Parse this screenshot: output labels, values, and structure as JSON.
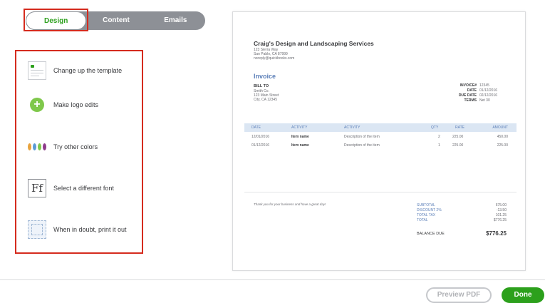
{
  "tabs": [
    {
      "label": "Design",
      "active": true
    },
    {
      "label": "Content",
      "active": false
    },
    {
      "label": "Emails",
      "active": false
    }
  ],
  "options": [
    {
      "label": "Change up the template",
      "icon": "template-icon"
    },
    {
      "label": "Make logo edits",
      "icon": "add-logo-icon"
    },
    {
      "label": "Try other colors",
      "icon": "color-palette-icon"
    },
    {
      "label": "Select a different font",
      "icon": "font-icon",
      "glyph": "Ff"
    },
    {
      "label": "When in doubt, print it out",
      "icon": "print-layout-icon"
    }
  ],
  "palette": [
    "#e8a33d",
    "#5b9bd5",
    "#7fc84b",
    "#8e3b8a"
  ],
  "invoice": {
    "company_name": "Craig's Design and Landscaping Services",
    "company_lines": [
      "123 Sierra Way",
      "San Pablo, CA 87999",
      "noreply@quickbooks.com"
    ],
    "title": "Invoice",
    "bill_to_label": "BILL TO",
    "bill_to_lines": [
      "Smith Co.",
      "123 Main Street",
      "City, CA 12345"
    ],
    "meta": [
      {
        "key": "INVOICE#",
        "value": "12345"
      },
      {
        "key": "DATE",
        "value": "01/12/2016"
      },
      {
        "key": "DUE DATE",
        "value": "02/12/2016"
      },
      {
        "key": "TERMS",
        "value": "Net 30"
      }
    ],
    "columns": [
      "DATE",
      "ACTIVITY",
      "ACTIVITY",
      "QTY",
      "RATE",
      "AMOUNT"
    ],
    "rows": [
      {
        "date": "12/01/2016",
        "item": "Item name",
        "desc": "Description of the item",
        "qty": "2",
        "rate": "225.00",
        "amount": "450.00"
      },
      {
        "date": "01/12/2016",
        "item": "Item name",
        "desc": "Description of the item",
        "qty": "1",
        "rate": "225.00",
        "amount": "225.00"
      }
    ],
    "thanks": "Thank you for your business and have a great day!",
    "totals": [
      {
        "key": "SUBTOTAL",
        "value": "675.00"
      },
      {
        "key": "DISCOUNT 2%",
        "value": "-13.50"
      },
      {
        "key": "TOTAL TAX",
        "value": "101.25"
      },
      {
        "key": "TOTAL",
        "value": "$776.25"
      }
    ],
    "balance_label": "BALANCE DUE",
    "balance_value": "$776.25"
  },
  "footer": {
    "preview_label": "Preview PDF",
    "done_label": "Done"
  }
}
